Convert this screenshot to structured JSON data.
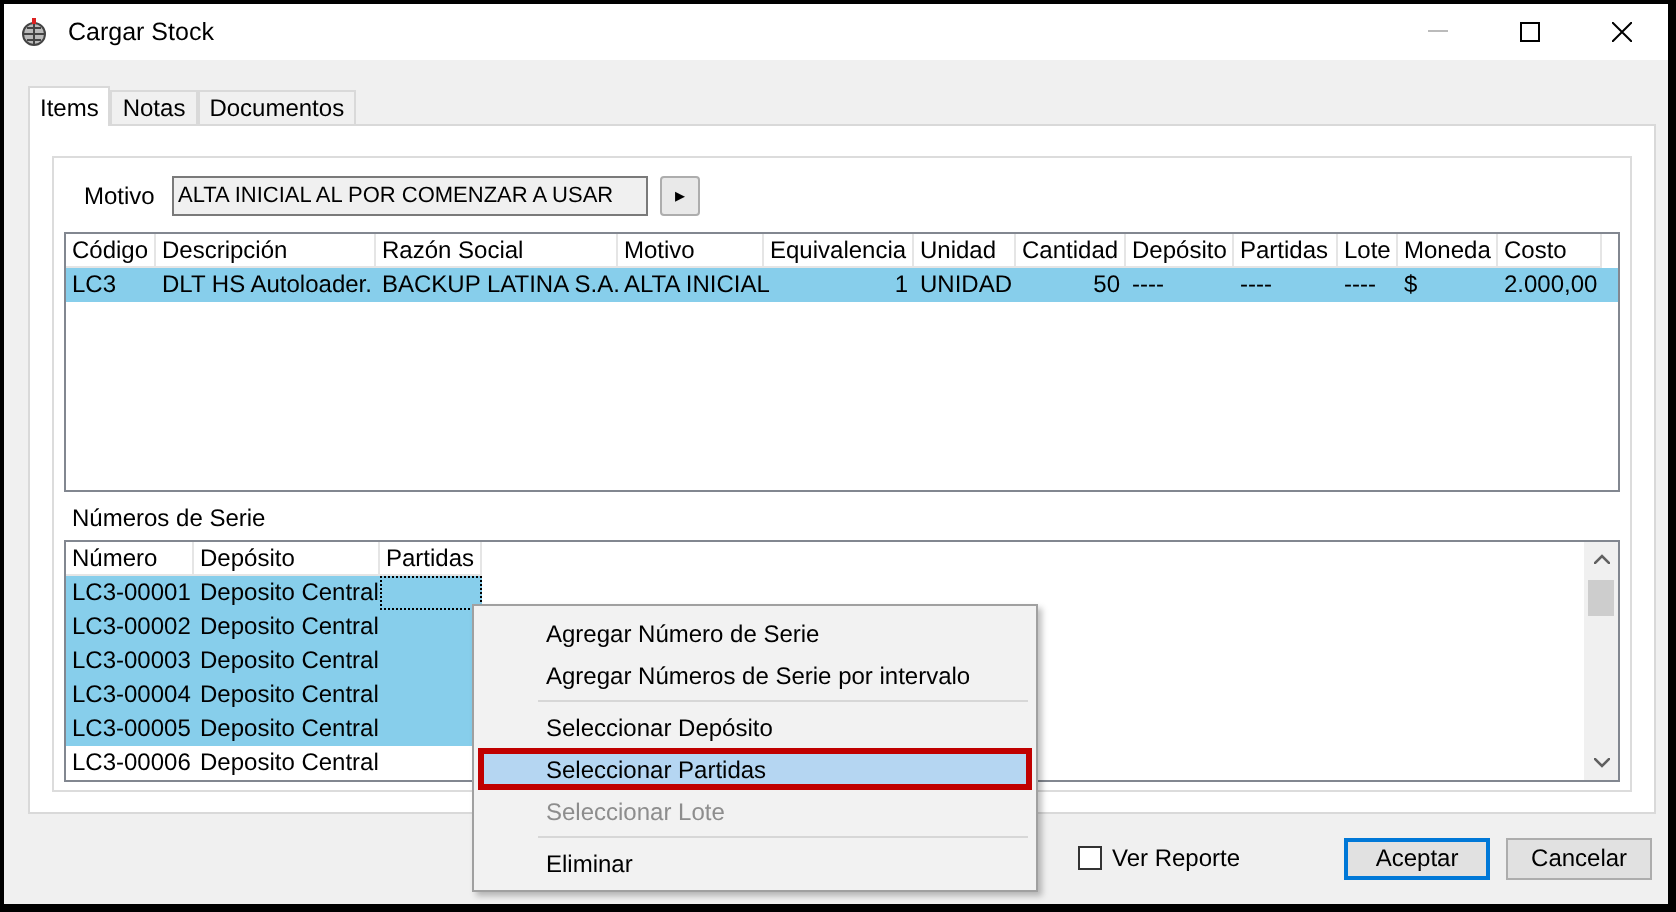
{
  "window": {
    "title": "Cargar Stock"
  },
  "tabs": [
    {
      "label": "Items",
      "selected": true
    },
    {
      "label": "Notas",
      "selected": false
    },
    {
      "label": "Documentos",
      "selected": false
    }
  ],
  "motivo": {
    "label": "Motivo",
    "value": "ALTA INICIAL AL POR COMENZAR A USAR",
    "button": "▸"
  },
  "items_table": {
    "columns": [
      {
        "label": "Código",
        "kind": "text"
      },
      {
        "label": "Descripción",
        "kind": "text"
      },
      {
        "label": "Razón Social",
        "kind": "text"
      },
      {
        "label": "Motivo",
        "kind": "text"
      },
      {
        "label": "Equivalencia",
        "kind": "number"
      },
      {
        "label": "Unidad",
        "kind": "text"
      },
      {
        "label": "Cantidad",
        "kind": "number"
      },
      {
        "label": "Depósito",
        "kind": "text"
      },
      {
        "label": "Partidas",
        "kind": "text"
      },
      {
        "label": "Lote",
        "kind": "text"
      },
      {
        "label": "Moneda",
        "kind": "text"
      },
      {
        "label": "Costo",
        "kind": "number"
      }
    ],
    "rows": [
      {
        "selected": true,
        "cells": [
          "LC3",
          "DLT HS Autoloader.",
          "BACKUP LATINA S.A.",
          "ALTA INICIAL",
          "1",
          "UNIDAD",
          "50",
          "----",
          "----",
          "----",
          "$",
          "2.000,00"
        ]
      }
    ]
  },
  "serials": {
    "label": "Números de Serie",
    "columns": [
      "Número",
      "Depósito",
      "Partidas"
    ],
    "rows": [
      {
        "selected": true,
        "cells": [
          "LC3-00001",
          "Deposito Central",
          ""
        ]
      },
      {
        "selected": true,
        "cells": [
          "LC3-00002",
          "Deposito Central",
          ""
        ]
      },
      {
        "selected": true,
        "cells": [
          "LC3-00003",
          "Deposito Central",
          ""
        ]
      },
      {
        "selected": true,
        "cells": [
          "LC3-00004",
          "Deposito Central",
          ""
        ]
      },
      {
        "selected": true,
        "cells": [
          "LC3-00005",
          "Deposito Central",
          ""
        ]
      },
      {
        "selected": false,
        "cells": [
          "LC3-00006",
          "Deposito Central",
          ""
        ]
      }
    ]
  },
  "context_menu": [
    {
      "kind": "item",
      "label": "Agregar Número de Serie",
      "selected": false,
      "disabled": false
    },
    {
      "kind": "item",
      "label": "Agregar Números de Serie por intervalo",
      "selected": false,
      "disabled": false
    },
    {
      "kind": "separator"
    },
    {
      "kind": "item",
      "label": "Seleccionar Depósito",
      "selected": false,
      "disabled": false
    },
    {
      "kind": "item",
      "label": "Seleccionar Partidas",
      "selected": true,
      "disabled": false
    },
    {
      "kind": "item",
      "label": "Seleccionar Lote",
      "selected": false,
      "disabled": true
    },
    {
      "kind": "separator"
    },
    {
      "kind": "item",
      "label": "Eliminar",
      "selected": false,
      "disabled": false
    }
  ],
  "ver_reporte": {
    "label": "Ver Reporte",
    "checked": false
  },
  "buttons": [
    {
      "label": "Aceptar",
      "default": true
    },
    {
      "label": "Cancelar",
      "default": false
    }
  ]
}
